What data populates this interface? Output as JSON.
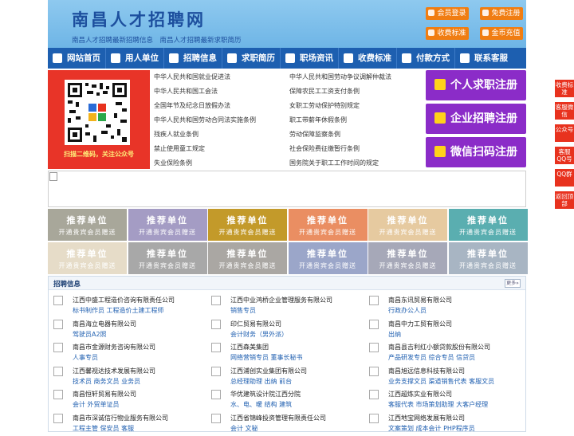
{
  "header": {
    "title": "南昌人才招聘网",
    "subtitle": "南昌人才招聘最新招聘信息　南昌人才招聘最新求职简历",
    "buttons": [
      "会员登录",
      "免费注册",
      "收费标准",
      "金币充值"
    ]
  },
  "nav": [
    "网站首页",
    "用人单位",
    "招聘信息",
    "求职简历",
    "职场资讯",
    "收费标准",
    "付款方式",
    "联系客服"
  ],
  "qr": {
    "caption": "扫描二维码，关注公众号"
  },
  "laws": [
    "中华人民共和国就业促进法",
    "中华人民共和国劳动争议调解仲裁法",
    "中华人民共和国工会法",
    "保障农民工工资支付条例",
    "全国年节及纪念日放假办法",
    "女职工劳动保护特别规定",
    "中华人民共和国劳动合同法实施条例",
    "职工带薪年休假条例",
    "残疾人就业条例",
    "劳动保障监察条例",
    "禁止使用童工规定",
    "社会保险费征缴暂行条例",
    "失业保险条例",
    "国务院关于职工工作时间的规定"
  ],
  "register": [
    "个人求职注册",
    "企业招聘注册",
    "微信扫码注册"
  ],
  "tiles": {
    "title": "推荐单位",
    "sub": "开通贵宾会员赠送",
    "colors": [
      "#a8a79a",
      "#a49cc4",
      "#c39a2a",
      "#ea8e62",
      "#e6caa0",
      "#5aaeb0",
      "#e6dcc8",
      "#a8a8a8",
      "#aaa7a3",
      "#9ba6c9",
      "#a6a8b8",
      "#a8b5c3"
    ]
  },
  "recruit": {
    "title": "招聘信息",
    "more": "更多»",
    "jobs": [
      {
        "company": "江西中盛工程造价咨询有限责任公司",
        "positions": "标书制作员 工程造价土建工程师"
      },
      {
        "company": "江西中业鸿桥企业管理服务有限公司",
        "positions": "销售专员"
      },
      {
        "company": "南昌东讯贸易有限公司",
        "positions": "行政办公人员"
      },
      {
        "company": "南昌海立电器有限公司",
        "positions": "驾驶员A2照"
      },
      {
        "company": "印仁贸易有限公司",
        "positions": "会计财务（男外派）"
      },
      {
        "company": "南昌中力工贸有限公司",
        "positions": "出纳"
      },
      {
        "company": "南昌市金源财务咨询有限公司",
        "positions": "人事专员"
      },
      {
        "company": "江西森美集团",
        "positions": "网络营销专员 董事长秘书"
      },
      {
        "company": "南昌县吉利红小额贷款股份有限公司",
        "positions": "产品研发专员 综合专员 信贷员"
      },
      {
        "company": "江西馨视达技术发展有限公司",
        "positions": "技术员 商务文员 业务员"
      },
      {
        "company": "江西浦创实业集团有限公司",
        "positions": "总经理助理 出纳 前台"
      },
      {
        "company": "南昌旭远信息科技有限公司",
        "positions": "业务支撑文员 渠道销售代表 客服文员"
      },
      {
        "company": "南昌恒轩贸易有限公司",
        "positions": "会计 外贸单证员"
      },
      {
        "company": "华优建筑设计院江西分院",
        "positions": "水、电、暖 结构 建筑"
      },
      {
        "company": "江西超炼实业有限公司",
        "positions": "客服代表 市场策划助理 大客户经理"
      },
      {
        "company": "南昌市深诚信行物业服务有限公司",
        "positions": "工程主管 保安员 客服"
      },
      {
        "company": "江西省锦峰投资管理有限责任公司",
        "positions": "会计 文秘"
      },
      {
        "company": "江西地宝网络发展有限公司",
        "positions": "文案策划 成本会计 PHP程序员"
      }
    ]
  },
  "float": [
    "收费标准",
    "客服微信",
    "公众号",
    "客服QQ号",
    "QQ群",
    "返回顶部"
  ]
}
